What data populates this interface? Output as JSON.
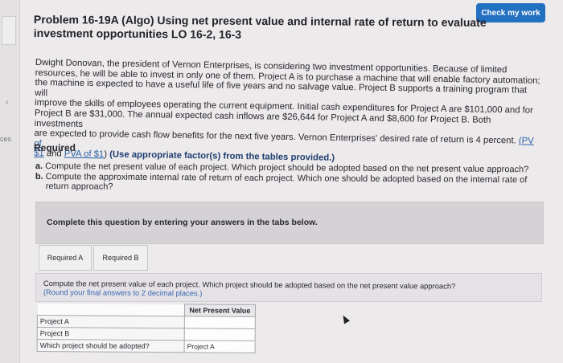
{
  "sidebar": {
    "chevron": "‹",
    "snippet": "ces"
  },
  "header": {
    "check_button": "Check my work",
    "title": "Problem 16-19A (Algo) Using net present value and internal rate of return to evaluate investment opportunities LO 16-2, 16-3"
  },
  "problem": {
    "lines": [
      "Dwight Donovan, the president of Vernon Enterprises, is considering two investment opportunities. Because of limited",
      "resources, he will be able to invest in only one of them. Project A is to purchase a machine that will enable factory automation;",
      "the machine is expected to have a useful life of five years and no salvage value. Project B supports a training program that will",
      "improve the skills of employees operating the current equipment. Initial cash expenditures for Project A are $101,000 and for",
      "Project B are $31,000. The annual expected cash inflows are $26,644 for Project A and $8,600 for Project B. Both investments",
      "are expected to provide cash flow benefits for the next five years. Vernon Enterprises' desired rate of return is 4 percent. "
    ],
    "link_pv": "(PV of",
    "link_fv": "$1",
    "and_text": " and ",
    "link_pva": "PVA of $1",
    "close_paren": ") ",
    "emphasis": "(Use appropriate factor(s) from the tables provided.)"
  },
  "required": {
    "heading": "Required",
    "a_letter": "a.",
    "a_text": " Compute the net present value of each project. Which project should be adopted based on the net present value approach?",
    "b_letter": "b.",
    "b_text": " Compute the approximate internal rate of return of each project. Which one should be adopted based on the internal rate of",
    "b_text2": "return approach?"
  },
  "complete_text": "Complete this question by entering your answers in the tabs below.",
  "tabs": [
    {
      "label": "Required A"
    },
    {
      "label": "Required B"
    }
  ],
  "instructions": {
    "line1": "Compute the net present value of each project. Which project should be adopted based on the net present value approach?",
    "line2": "(Round your final answers to 2 decimal places.)"
  },
  "table": {
    "header": "Net Present Value",
    "rows": [
      {
        "label": "Project A",
        "value": ""
      },
      {
        "label": "Project B",
        "value": ""
      },
      {
        "label": "Which project should be adopted?",
        "value": "Project A"
      }
    ]
  }
}
